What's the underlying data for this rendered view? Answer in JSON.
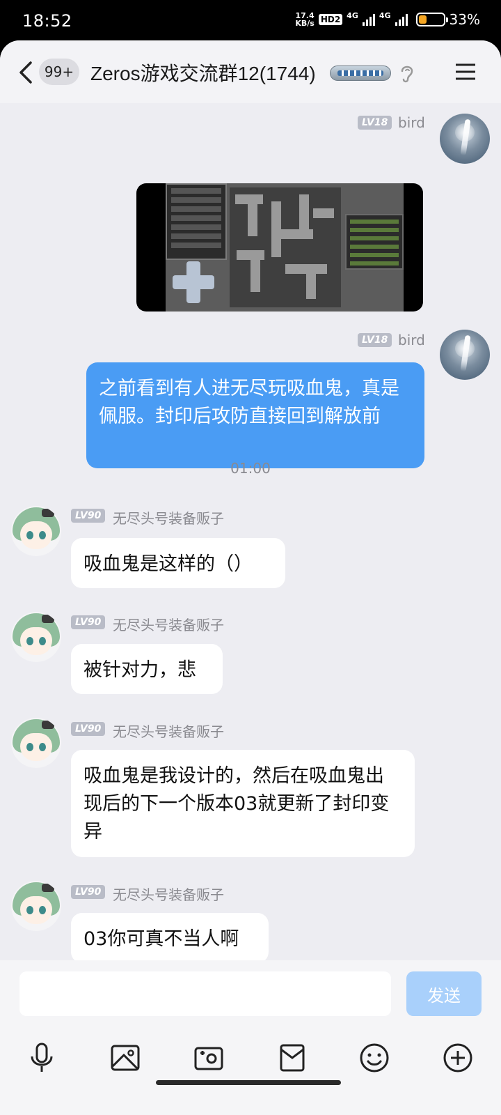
{
  "status_bar": {
    "time": "18:52",
    "net_speed_value": "17.4",
    "net_speed_unit": "KB/s",
    "hd_label": "HD2",
    "net_1": "4G",
    "net_2": "4G",
    "battery_level": 0.33,
    "battery_percent": "33%"
  },
  "header": {
    "back_icon": "chevron-left-icon",
    "unread_badge": "99+",
    "title": "Zeros游戏交流群12(1744)",
    "ear_icon": "ear-icon",
    "menu_icon": "menu-icon"
  },
  "messages": [
    {
      "sender": "bird",
      "level": "LV18",
      "side": "right",
      "type": "image",
      "image_desc": "game-screenshot"
    },
    {
      "sender": "bird",
      "level": "LV18",
      "side": "right",
      "type": "text",
      "text": "之前看到有人进无尽玩吸血鬼，真是佩服。封印后攻防直接回到解放前"
    },
    {
      "type": "time",
      "text": "01:00"
    },
    {
      "sender": "无尽头号装备贩子",
      "level": "LV90",
      "side": "left",
      "type": "text",
      "text": "吸血鬼是这样的（）"
    },
    {
      "sender": "无尽头号装备贩子",
      "level": "LV90",
      "side": "left",
      "type": "text",
      "text": "被针对力，悲"
    },
    {
      "sender": "无尽头号装备贩子",
      "level": "LV90",
      "side": "left",
      "type": "text",
      "text": "吸血鬼是我设计的，然后在吸血鬼出现后的下一个版本03就更新了封印变异"
    },
    {
      "sender": "无尽头号装备贩子",
      "level": "LV90",
      "side": "left",
      "type": "text",
      "text": "03你可真不当人啊"
    }
  ],
  "input": {
    "value": "",
    "send_label": "发送"
  },
  "toolbar": [
    "microphone-icon",
    "image-icon",
    "camera-icon",
    "red-packet-icon",
    "emoji-icon",
    "plus-icon"
  ],
  "colors": {
    "self_bubble": "#4a9cf4",
    "send_button": "#a9d0fb",
    "background": "#ededf2"
  }
}
